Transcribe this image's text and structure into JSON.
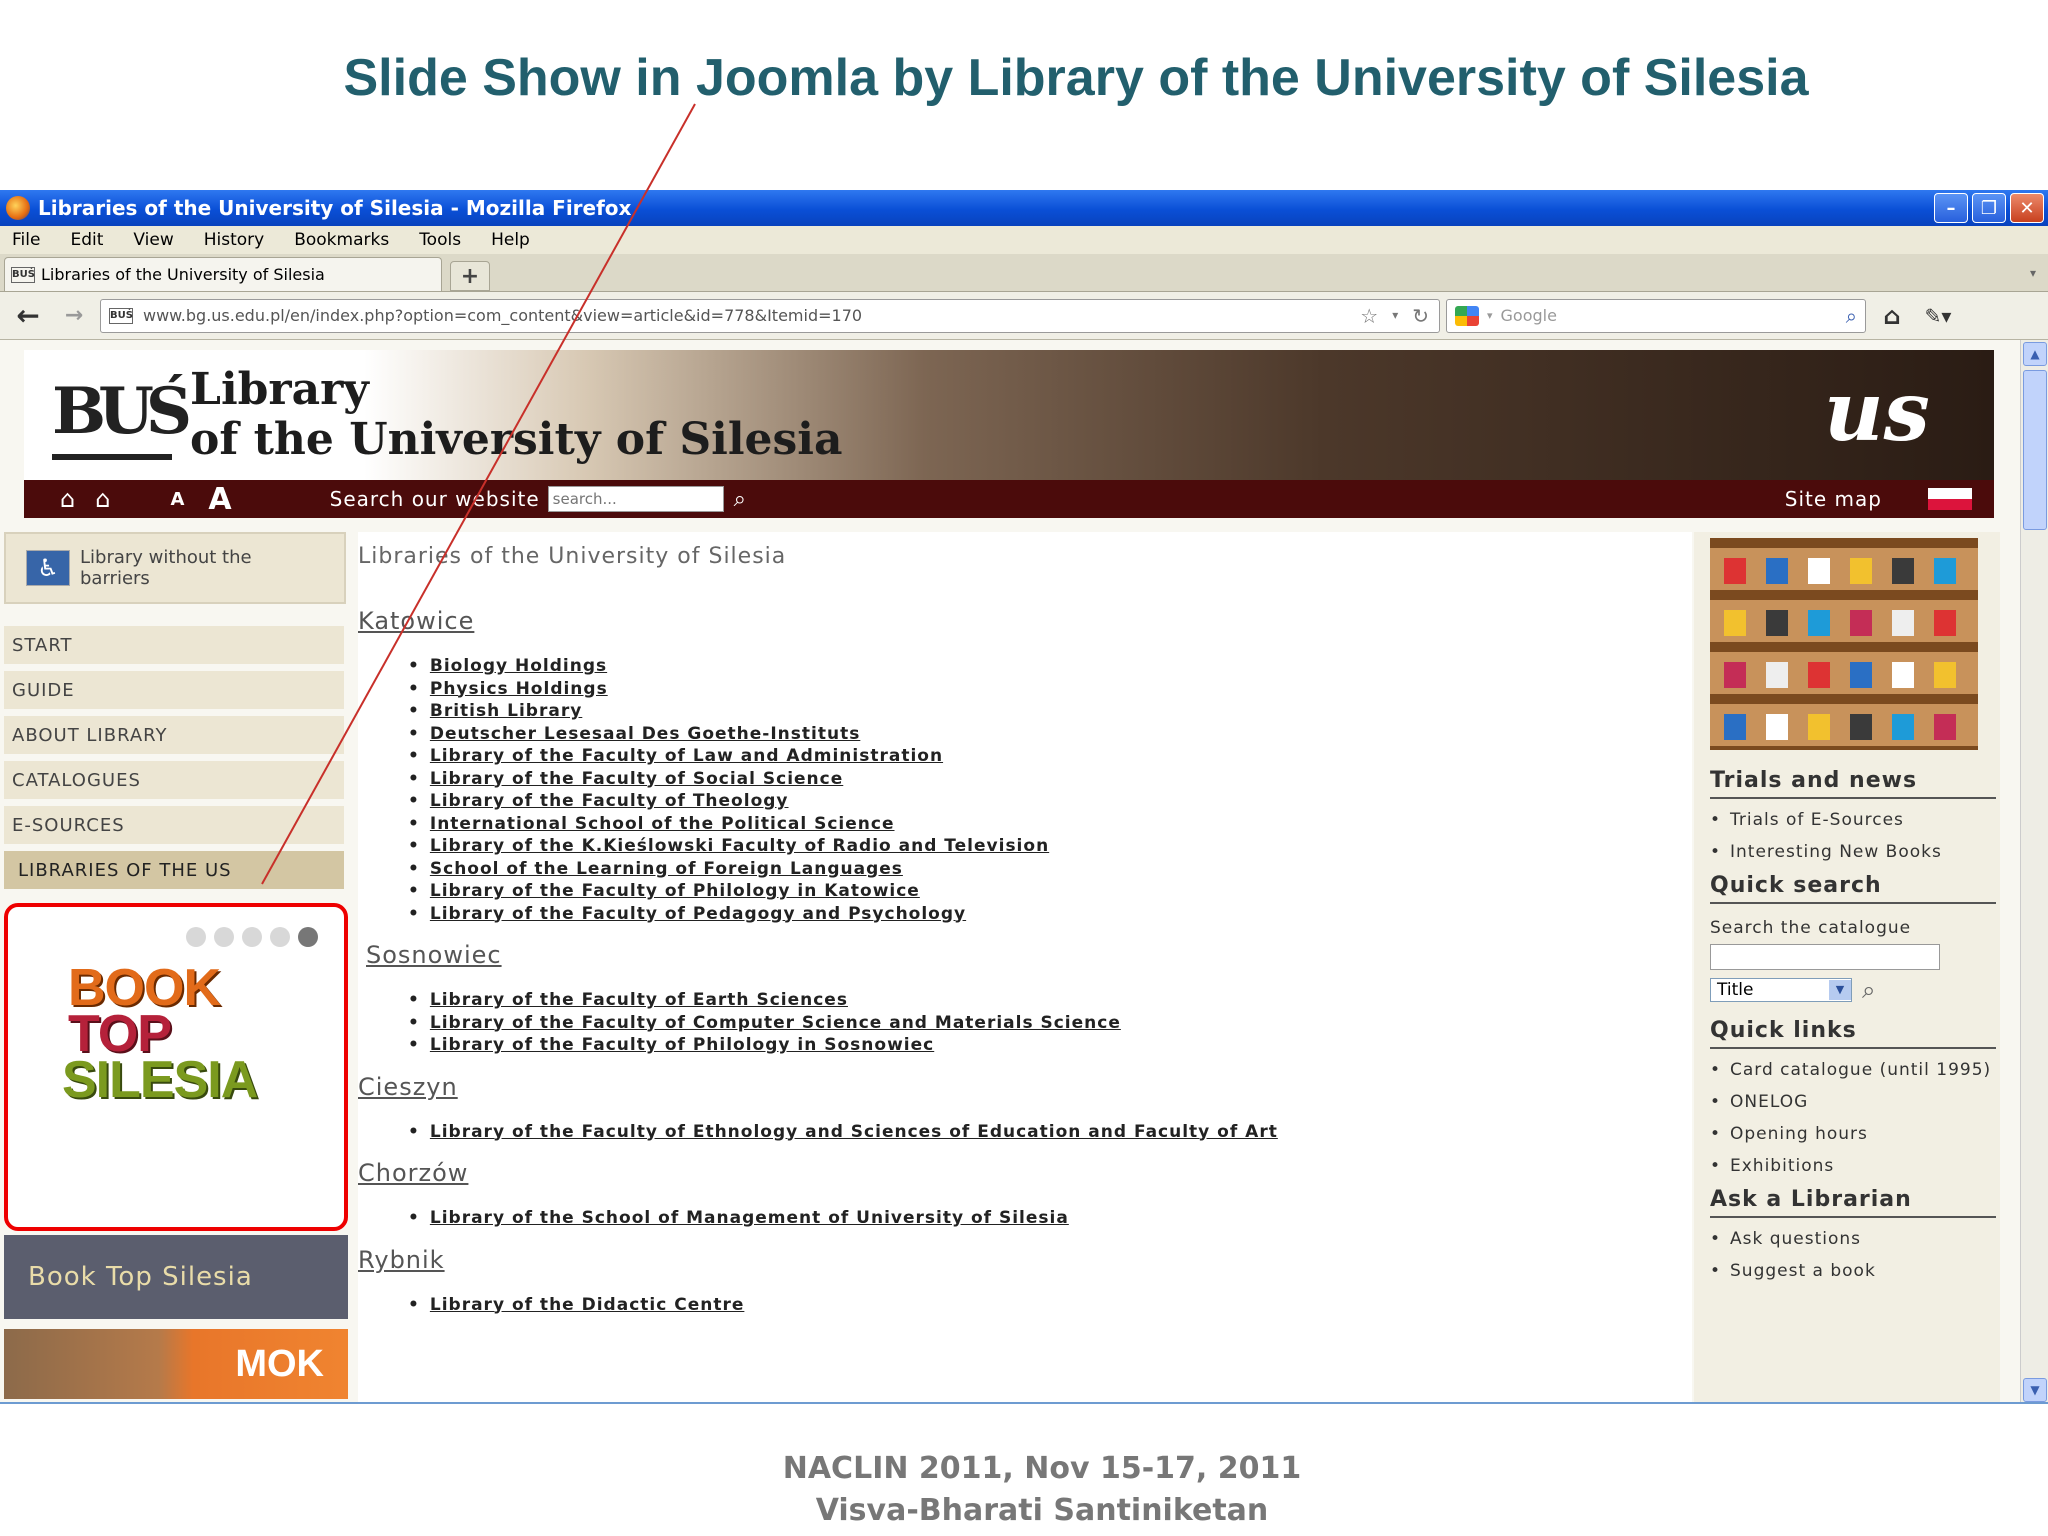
{
  "slide": {
    "title": "Slide Show in Joomla by Library of the University of Silesia",
    "footer_line1": "NACLIN 2011, Nov 15-17, 2011",
    "footer_line2": "Visva-Bharati Santiniketan"
  },
  "browser": {
    "window_title": "Libraries of the University of Silesia - Mozilla Firefox",
    "menu": [
      "File",
      "Edit",
      "View",
      "History",
      "Bookmarks",
      "Tools",
      "Help"
    ],
    "tab_label": "Libraries of the University of Silesia",
    "url": "www.bg.us.edu.pl/en/index.php?option=com_content&view=article&id=778&Itemid=170",
    "search_placeholder": "Google",
    "favicon_text": "BUŚ"
  },
  "site": {
    "logo_text": "BUŚ",
    "name_line1": "Library",
    "name_line2": "of the University of Silesia",
    "us_logo": "us",
    "toolbar": {
      "font_small": "A",
      "font_large": "A",
      "search_label": "Search our website",
      "search_placeholder": "search...",
      "site_map": "Site map"
    }
  },
  "left": {
    "access_text": "Library without the barriers",
    "menu": [
      "START",
      "GUIDE",
      "ABOUT LIBRARY",
      "CATALOGUES",
      "E-SOURCES",
      "LIBRARIES OF THE US"
    ],
    "slideshow": {
      "line1": "BOOK",
      "line2": "TOP",
      "line3": "SILESIA",
      "dot_count": 5,
      "active_dot": 5
    },
    "slide_caption": "Book Top Silesia",
    "mok_label": "MOK"
  },
  "main": {
    "page_title": "Libraries of the University of Silesia",
    "cities": [
      {
        "name": "Katowice",
        "libraries": [
          "Biology Holdings",
          "Physics Holdings",
          "British Library",
          "Deutscher Lesesaal Des Goethe-Instituts",
          "Library of the Faculty of Law and Administration",
          "Library of the Faculty of Social Science",
          "Library of the Faculty of Theology",
          "International School of the Political Science",
          "Library of the K.Kieślowski Faculty of Radio and Television",
          "School of the Learning of Foreign Languages",
          "Library of the Faculty of Philology in Katowice",
          "Library of the Faculty of Pedagogy and Psychology"
        ]
      },
      {
        "name": "Sosnowiec",
        "libraries": [
          "Library of the Faculty of Earth Sciences",
          "Library of the Faculty of Computer Science and Materials Science",
          "Library of the Faculty of Philology in Sosnowiec"
        ]
      },
      {
        "name": "Cieszyn",
        "libraries": [
          "Library of the Faculty of Ethnology and Sciences of Education and Faculty of Art"
        ]
      },
      {
        "name": "Chorzów",
        "libraries": [
          "Library of the School of Management of University of Silesia"
        ]
      },
      {
        "name": "Rybnik",
        "libraries": [
          "Library of the Didactic Centre"
        ]
      }
    ]
  },
  "right": {
    "trials_heading": "Trials and news",
    "trials": [
      "Trials of E-Sources",
      "Interesting New Books"
    ],
    "quick_search_heading": "Quick search",
    "quick_search_label": "Search the catalogue",
    "quick_search_select": "Title",
    "quick_links_heading": "Quick links",
    "quick_links": [
      "Card catalogue (until 1995)",
      "ONELOG",
      "Opening hours",
      "Exhibitions"
    ],
    "ask_heading": "Ask a Librarian",
    "ask_links": [
      "Ask questions",
      "Suggest a book"
    ]
  },
  "colors": {
    "slide_title": "#225f6d",
    "toolbar_strip": "#4b0b0b",
    "highlight_border": "#e00000",
    "annotation_line": "#c8302a"
  }
}
